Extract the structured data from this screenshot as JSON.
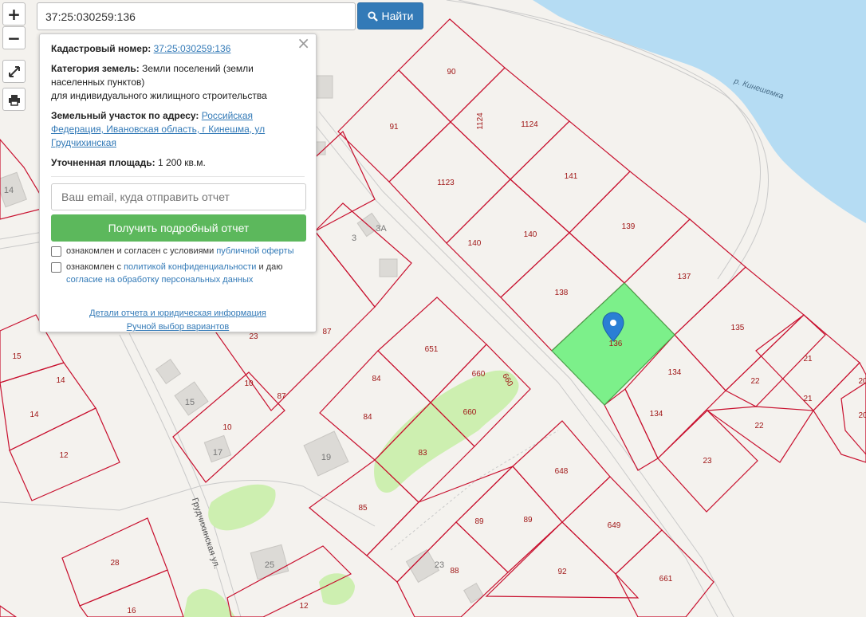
{
  "search": {
    "value": "37:25:030259:136",
    "button_label": "Найти"
  },
  "controls": {
    "zoom_in": "+",
    "zoom_out": "−"
  },
  "popup": {
    "cadastral_label": "Кадастровый номер:",
    "cadastral_value": "37:25:030259:136",
    "category_label": "Категория земель:",
    "category_value": "Земли поселений (земли населенных пунктов)",
    "category_use": "для индивидуального жилищного строительства",
    "address_label": "Земельный участок по адресу:",
    "address_value": "Российская Федерация, Ивановская область, г Кинешма, ул Грудчихинская",
    "area_label": "Уточненная площадь:",
    "area_value": "1 200 кв.м.",
    "email_placeholder": "Ваш email, куда отправить отчет",
    "report_button": "Получить подробный отчет",
    "check1_text": "ознакомлен и согласен с условиями ",
    "check1_link": "публичной оферты",
    "check2_text": "ознакомлен с ",
    "check2_link": "политикой конфиденциальности",
    "check2_text2": " и даю ",
    "check2_link2": "согласие на обработку персональных данных",
    "details_link": "Детали отчета и юридическая информация",
    "manual_link": "Ручной выбор вариантов"
  },
  "map": {
    "river_label": "р. Кинешемка",
    "street_label": "Грудчихинская ул.",
    "selected_parcel": "136",
    "parcel_color": "#c8102e",
    "selected_fill": "#7cf08a",
    "water_color": "#b5dcf3",
    "park_color": "#cdefb0",
    "parcels": [
      "90",
      "91",
      "1124",
      "1124",
      "1123",
      "141",
      "140",
      "140",
      "139",
      "138",
      "137",
      "136",
      "135",
      "134",
      "134",
      "21",
      "21",
      "22",
      "22",
      "23",
      "20",
      "20",
      "651",
      "660",
      "660",
      "660",
      "84",
      "84",
      "83",
      "85",
      "87",
      "87",
      "23",
      "15",
      "14",
      "14",
      "12",
      "10",
      "10",
      "648",
      "649",
      "89",
      "89",
      "92",
      "661",
      "88",
      "28",
      "16",
      "12",
      "3"
    ],
    "buildings": [
      "3A",
      "3",
      "14",
      "15",
      "17",
      "19",
      "25",
      "23"
    ]
  }
}
